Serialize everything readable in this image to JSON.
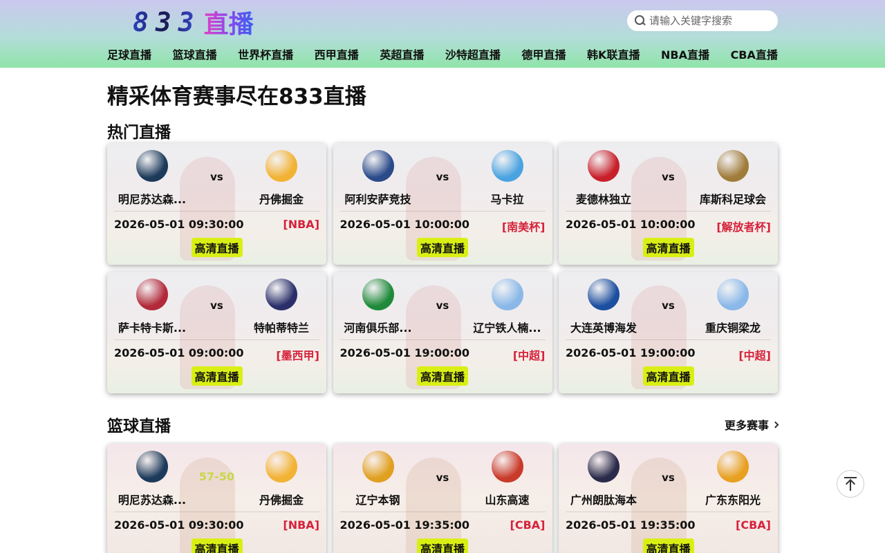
{
  "header": {
    "logo_digits": "833",
    "logo_text": "直播",
    "search_placeholder": "请输入关键字搜索"
  },
  "nav": [
    "足球直播",
    "篮球直播",
    "世界杯直播",
    "西甲直播",
    "英超直播",
    "沙特超直播",
    "德甲直播",
    "韩K联直播",
    "NBA直播",
    "CBA直播"
  ],
  "page_title": "精采体育赛事尽在833直播",
  "hot": {
    "title": "热门直播",
    "matches": [
      {
        "home": "明尼苏达森...",
        "away": "丹佛掘金",
        "vs": "vs",
        "time": "2026-05-01 09:30:00",
        "league": "[NBA]",
        "button": "高清直播",
        "home_color": "#1c3a5a",
        "away_color": "#f2b233"
      },
      {
        "home": "阿利安萨竞技",
        "away": "马卡拉",
        "vs": "vs",
        "time": "2026-05-01 10:00:00",
        "league": "[南美杯]",
        "button": "高清直播",
        "home_color": "#2a4a8a",
        "away_color": "#4aa3e0"
      },
      {
        "home": "麦德林独立",
        "away": "库斯科足球会",
        "vs": "vs",
        "time": "2026-05-01 10:00:00",
        "league": "[解放者杯]",
        "button": "高清直播",
        "home_color": "#c8202b",
        "away_color": "#a07c3a"
      },
      {
        "home": "萨卡特卡斯...",
        "away": "特帕蒂特兰",
        "vs": "vs",
        "time": "2026-05-01 09:00:00",
        "league": "[墨西甲]",
        "button": "高清直播",
        "home_color": "#b22a3a",
        "away_color": "#2a2f6a"
      },
      {
        "home": "河南俱乐部...",
        "away": "辽宁铁人楠...",
        "vs": "vs",
        "time": "2026-05-01 19:00:00",
        "league": "[中超]",
        "button": "高清直播",
        "home_color": "#1f8a3a",
        "away_color": "#8ab8e8"
      },
      {
        "home": "大连英博海发",
        "away": "重庆铜梁龙",
        "vs": "vs",
        "time": "2026-05-01 19:00:00",
        "league": "[中超]",
        "button": "高清直播",
        "home_color": "#1c4fa0",
        "away_color": "#8ab8e8"
      }
    ]
  },
  "basketball": {
    "title": "篮球直播",
    "more": "更多赛事",
    "matches": [
      {
        "home": "明尼苏达森...",
        "away": "丹佛掘金",
        "vs": "",
        "score": "57-50",
        "time": "2026-05-01 09:30:00",
        "league": "[NBA]",
        "button": "高清直播",
        "home_color": "#1c3a5a",
        "away_color": "#f2b233"
      },
      {
        "home": "辽宁本钢",
        "away": "山东高速",
        "vs": "vs",
        "score": "",
        "time": "2026-05-01 19:35:00",
        "league": "[CBA]",
        "button": "高清直播",
        "home_color": "#e0a020",
        "away_color": "#c83a2a"
      },
      {
        "home": "广州朗肽海本",
        "away": "广东东阳光",
        "vs": "vs",
        "score": "",
        "time": "2026-05-01 19:35:00",
        "league": "[CBA]",
        "button": "高清直播",
        "home_color": "#2a2a4a",
        "away_color": "#e8a020"
      }
    ]
  }
}
